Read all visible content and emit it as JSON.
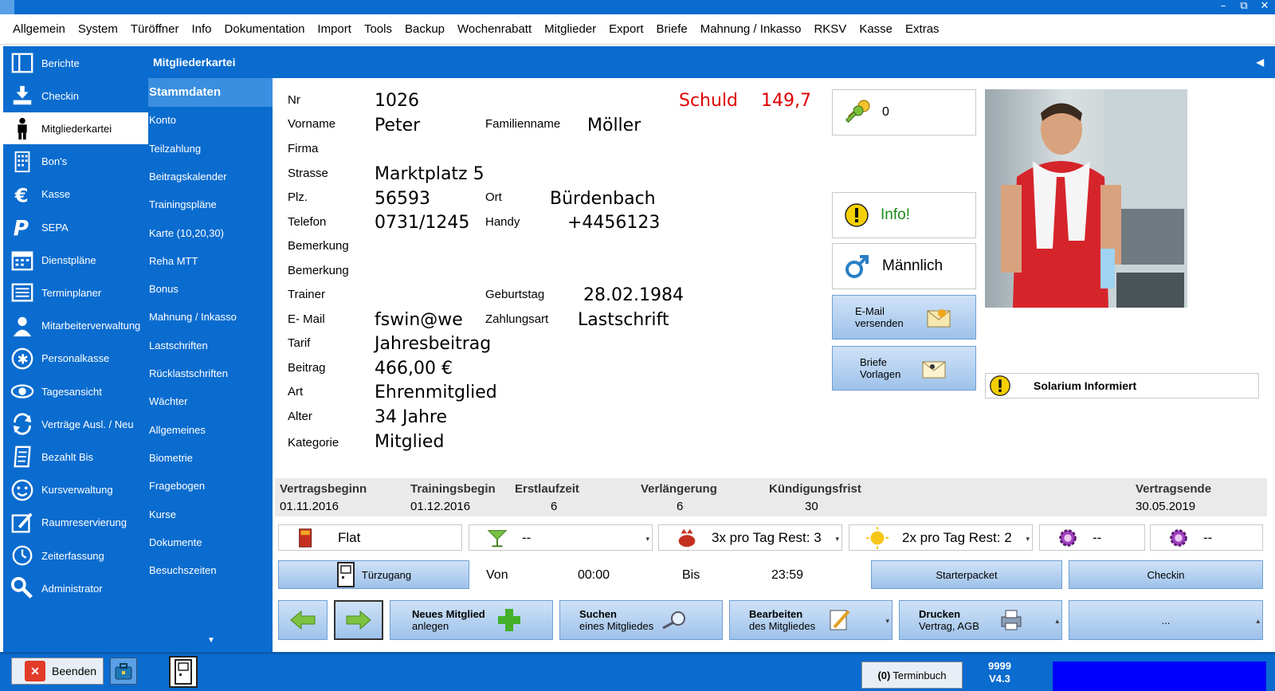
{
  "menu": [
    "Allgemein",
    "System",
    "Türöffner",
    "Info",
    "Dokumentation",
    "Import",
    "Tools",
    "Backup",
    "Wochenrabatt",
    "Mitglieder",
    "Export",
    "Briefe",
    "Mahnung / Inkasso",
    "RKSV",
    "Kasse",
    "Extras"
  ],
  "window": {
    "minimize": "–",
    "restore": "⧉",
    "close": "✕"
  },
  "sidebar": [
    "Berichte",
    "Checkin",
    "Mitgliederkartei",
    "Bon's",
    "Kasse",
    "SEPA",
    "Dienstpläne",
    "Terminplaner",
    "Mitarbeiterverwaltung",
    "Personalkasse",
    "Tagesansicht",
    "Verträge Ausl. / Neu",
    "Bezahlt Bis",
    "Kursverwaltung",
    "Raumreservierung",
    "Zeiterfassung",
    "Administrator"
  ],
  "subnav_title": "Mitgliederkartei",
  "subnav": [
    "Stammdaten",
    "Konto",
    "Teilzahlung",
    "Beitragskalender",
    "Trainingspläne",
    "Karte (10,20,30)",
    "Reha MTT",
    "Bonus",
    "Mahnung / Inkasso",
    "Lastschriften",
    "Rücklastschriften",
    "Wächter",
    "Allgemeines",
    "Biometrie",
    "Fragebogen",
    "Kurse",
    "Dokumente",
    "Besuchszeiten"
  ],
  "labels": {
    "nr": "Nr",
    "vorname": "Vorname",
    "familienname": "Familienname",
    "firma": "Firma",
    "strasse": "Strasse",
    "plz": "Plz.",
    "ort": "Ort",
    "telefon": "Telefon",
    "handy": "Handy",
    "bemerkung1": "Bemerkung",
    "bemerkung2": "Bemerkung",
    "trainer": "Trainer",
    "geburtstag": "Geburtstag",
    "email": "E- Mail",
    "zahlungsart": "Zahlungsart",
    "tarif": "Tarif",
    "beitrag": "Beitrag",
    "art": "Art",
    "alter": "Alter",
    "kategorie": "Kategorie",
    "schuld": "Schuld"
  },
  "member": {
    "nr": "1026",
    "vorname": "Peter",
    "familienname": "Möller",
    "strasse": "Marktplatz 5",
    "plz": "56593",
    "ort": "Bürdenbach",
    "telefon": "0731/1245",
    "handy": "+4456123",
    "geburtstag": "28.02.1984",
    "email": "fswin@we",
    "zahlungsart": "Lastschrift",
    "tarif": "Jahresbeitrag",
    "beitrag": "466,00 €",
    "art": "Ehrenmitglied",
    "alter": "34 Jahre",
    "kategorie": "Mitglied",
    "schuld": "149,7"
  },
  "side_panel": {
    "keys": "0",
    "info": "Info!",
    "gender": "Männlich",
    "email_btn": [
      "E-Mail",
      "versenden"
    ],
    "briefe_btn": [
      "Briefe",
      "Vorlagen"
    ],
    "solarium": "Solarium Informiert"
  },
  "contract": {
    "headers": [
      "Vertragsbeginn",
      "Trainingsbegin",
      "Erstlaufzeit",
      "Verlängerung",
      "Kündigungsfrist",
      "Vertragsende"
    ],
    "values": [
      "01.11.2016",
      "01.12.2016",
      "6",
      "6",
      "30",
      "30.05.2019"
    ]
  },
  "options": [
    "Flat",
    "--",
    "3x pro Tag Rest: 3",
    "2x pro Tag Rest: 2",
    "--",
    "--"
  ],
  "door": {
    "button": "Türzugang",
    "von_label": "Von",
    "von": "00:00",
    "bis_label": "Bis",
    "bis": "23:59",
    "starter": "Starterpacket",
    "checkin": "Checkin"
  },
  "actions": {
    "new": [
      "Neues Mitglied",
      "anlegen"
    ],
    "search": [
      "Suchen",
      "eines Mitgliedes"
    ],
    "edit": [
      "Bearbeiten",
      "des Mitgliedes"
    ],
    "print": [
      "Drucken",
      "Vertrag, AGB"
    ],
    "more": "..."
  },
  "status": {
    "quit": "Beenden",
    "termin_count": "(0)",
    "termin": "Terminbuch",
    "code": "9999",
    "version": "V4.3"
  },
  "colors": {
    "accent": "#0a6ccf",
    "debt": "#e00000"
  }
}
